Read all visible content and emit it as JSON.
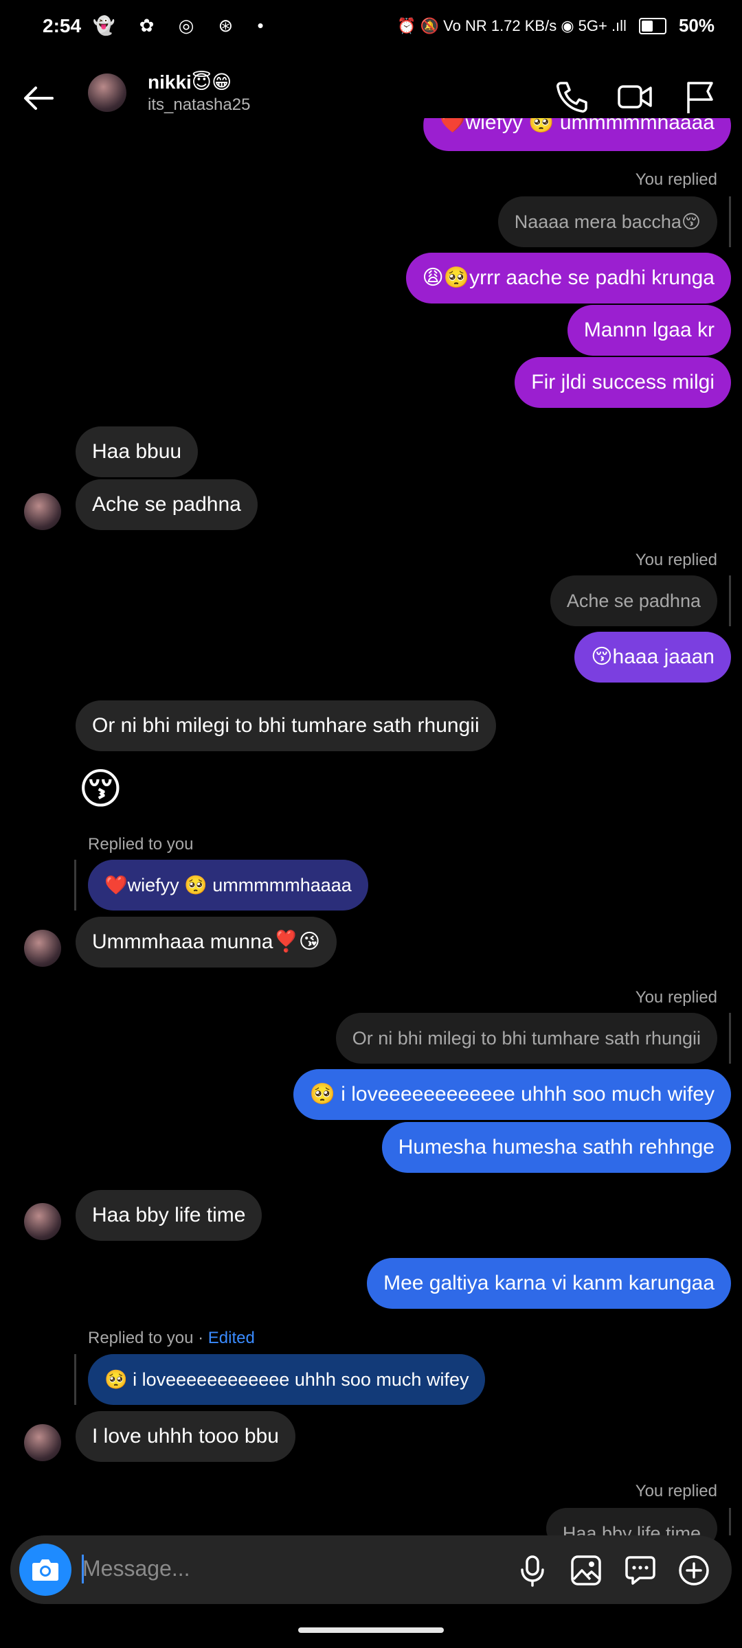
{
  "status": {
    "time": "2:54",
    "left_icons": "👻 ✿ ◎ ⊛ •",
    "right_text": "⏰ 🔕 Vo NR 1.72 KB/s ◉ 5G+ .ıll",
    "battery": "50%"
  },
  "header": {
    "name": "nikki😇😁",
    "username": "its_natasha25"
  },
  "messages": {
    "partial_top": "❤️wiefyy 🥺 ummmmmhaaaa",
    "you_replied_1": "You replied",
    "quote_1": "Naaaa mera baccha😚",
    "m1": "😩🥺yrrr aache se padhi krunga",
    "m2": "Mannn lgaa kr",
    "m3": "Fir jldi success milgi",
    "r1": "Haa bbuu",
    "r2": "Ache se padhna",
    "you_replied_2": "You replied",
    "quote_2": "Ache se padhna",
    "m4": "😚haaa jaaan",
    "r3": "Or ni bhi milegi to bhi tumhare sath rhungii",
    "r4_emoji": "😚",
    "replied_to_you_1": "Replied to you",
    "quote_3": "❤️wiefyy 🥺 ummmmmhaaaa",
    "r5": "Ummmhaaa munna❣️😘",
    "you_replied_3": "You replied",
    "quote_4": "Or ni bhi milegi to bhi tumhare sath rhungii",
    "m5": "🥺 i loveeeeeeeeeeee uhhh soo much wifey",
    "m6": "Humesha humesha sathh rehhnge",
    "r6": "Haa bby life time",
    "m7": "Mee galtiya karna vi kanm karungaa",
    "replied_to_you_2": "Replied to you · ",
    "edited": "Edited",
    "quote_5": "🥺 i loveeeeeeeeeeee uhhh soo much wifey",
    "r7": "I love uhhh tooo bbu",
    "you_replied_4": "You replied",
    "quote_6": "Haa bby life time"
  },
  "composer": {
    "placeholder": "Message..."
  },
  "colors": {
    "sent_purple": "#9b1fd0",
    "sent_violet": "#7b3fe0",
    "sent_blue": "#2f6ae8",
    "received": "#262626",
    "accent": "#1e8bff"
  }
}
